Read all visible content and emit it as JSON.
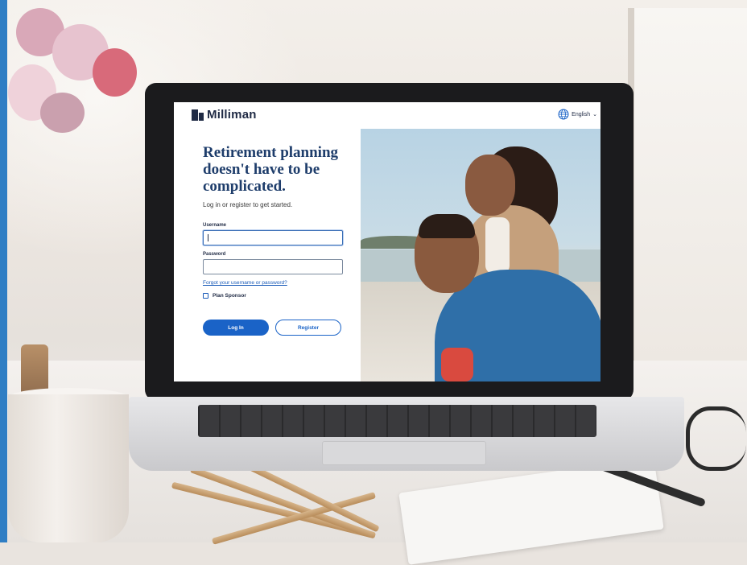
{
  "page": {
    "logo_text": "Milliman",
    "language": "English",
    "headline": "Retirement planning doesn't have to be complicated.",
    "subheading": "Log in or register to get started.",
    "username_label": "Username",
    "username_value": "",
    "password_label": "Password",
    "password_value": "",
    "forgot_link": "Forgot your username or password?",
    "plan_sponsor_label": "Plan Sponsor",
    "login_button": "Log In",
    "register_button": "Register"
  },
  "colors": {
    "brand_blue": "#1a63c7",
    "headline_navy": "#1e3d6b",
    "accent_side_bar": "#2f7ec4"
  },
  "icons": [
    "logo-mark-icon",
    "globe-icon",
    "chevron-down-icon",
    "checkbox-icon"
  ]
}
